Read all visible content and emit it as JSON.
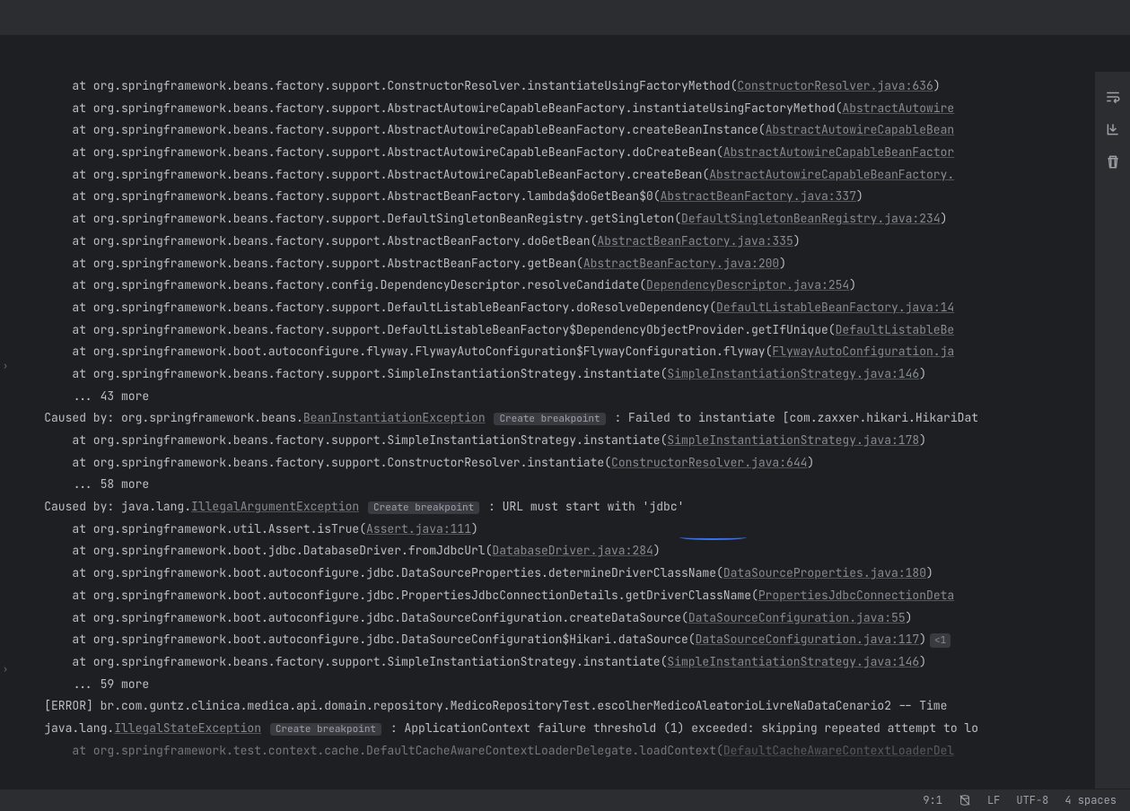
{
  "lines": [
    {
      "indent": "        ",
      "prefix": "at org.springframework.beans.factory.support.ConstructorResolver.instantiateUsingFactoryMethod(",
      "link": "ConstructorResolver.java:636",
      "linkGrey": true,
      "suffix": ")"
    },
    {
      "indent": "        ",
      "prefix": "at org.springframework.beans.factory.support.AbstractAutowireCapableBeanFactory.instantiateUsingFactoryMethod(",
      "link": "AbstractAutowire",
      "linkCut": true,
      "suffix": ""
    },
    {
      "indent": "        ",
      "prefix": "at org.springframework.beans.factory.support.AbstractAutowireCapableBeanFactory.createBeanInstance(",
      "link": "AbstractAutowireCapableBean",
      "linkCut": true,
      "suffix": ""
    },
    {
      "indent": "        ",
      "prefix": "at org.springframework.beans.factory.support.AbstractAutowireCapableBeanFactory.doCreateBean(",
      "link": "AbstractAutowireCapableBeanFactor",
      "linkCut": true,
      "suffix": ""
    },
    {
      "indent": "        ",
      "prefix": "at org.springframework.beans.factory.support.AbstractAutowireCapableBeanFactory.createBean(",
      "link": "AbstractAutowireCapableBeanFactory.",
      "linkCut": true,
      "suffix": ""
    },
    {
      "indent": "        ",
      "prefix": "at org.springframework.beans.factory.support.AbstractBeanFactory.lambda$doGetBean$0(",
      "link": "AbstractBeanFactory.java:337",
      "linkGrey": true,
      "suffix": ")"
    },
    {
      "indent": "        ",
      "prefix": "at org.springframework.beans.factory.support.DefaultSingletonBeanRegistry.getSingleton(",
      "link": "DefaultSingletonBeanRegistry.java:234",
      "linkGrey": true,
      "suffix": ")"
    },
    {
      "indent": "        ",
      "prefix": "at org.springframework.beans.factory.support.AbstractBeanFactory.doGetBean(",
      "link": "AbstractBeanFactory.java:335",
      "linkGrey": true,
      "suffix": ")"
    },
    {
      "indent": "        ",
      "prefix": "at org.springframework.beans.factory.support.AbstractBeanFactory.getBean(",
      "link": "AbstractBeanFactory.java:200",
      "linkGrey": true,
      "suffix": ")"
    },
    {
      "indent": "        ",
      "prefix": "at org.springframework.beans.factory.config.DependencyDescriptor.resolveCandidate(",
      "link": "DependencyDescriptor.java:254",
      "linkGrey": true,
      "suffix": ")"
    },
    {
      "indent": "        ",
      "prefix": "at org.springframework.beans.factory.support.DefaultListableBeanFactory.doResolveDependency(",
      "link": "DefaultListableBeanFactory.java:14",
      "linkCut": true,
      "suffix": ""
    },
    {
      "indent": "        ",
      "prefix": "at org.springframework.beans.factory.support.DefaultListableBeanFactory$DependencyObjectProvider.getIfUnique(",
      "link": "DefaultListableBe",
      "linkCut": true,
      "suffix": ""
    },
    {
      "indent": "        ",
      "prefix": "at org.springframework.boot.autoconfigure.flyway.FlywayAutoConfiguration$FlywayConfiguration.flyway(",
      "link": "FlywayAutoConfiguration.ja",
      "linkCut": true,
      "suffix": "",
      "fold": true
    },
    {
      "indent": "        ",
      "prefix": "at org.springframework.beans.factory.support.SimpleInstantiationStrategy.instantiate(",
      "link": "SimpleInstantiationStrategy.java:146",
      "linkGrey": true,
      "suffix": ")"
    },
    {
      "indent": "        ",
      "prefix": "... 43 more",
      "plain": true
    }
  ],
  "caused1": {
    "prefix": "    Caused by: org.springframework.beans.",
    "exceptionLink": "BeanInstantiationException",
    "breakpoint": "Create breakpoint",
    "suffix": ": Failed to instantiate [com.zaxxer.hikari.HikariDat"
  },
  "caused1_lines": [
    {
      "indent": "        ",
      "prefix": "at org.springframework.beans.factory.support.SimpleInstantiationStrategy.instantiate(",
      "link": "SimpleInstantiationStrategy.java:178",
      "linkGrey": true,
      "suffix": ")"
    },
    {
      "indent": "        ",
      "prefix": "at org.springframework.beans.factory.support.ConstructorResolver.instantiate(",
      "link": "ConstructorResolver.java:644",
      "linkGrey": true,
      "suffix": ")"
    },
    {
      "indent": "        ",
      "prefix": "... 58 more",
      "plain": true
    }
  ],
  "caused2": {
    "prefix": "    Caused by: java.lang.",
    "exceptionLink": "IllegalArgumentException",
    "breakpoint": "Create breakpoint",
    "suffix": ": URL must start with 'jdbc'"
  },
  "caused2_lines": [
    {
      "indent": "        ",
      "prefix": "at org.springframework.util.Assert.isTrue(",
      "link": "Assert.java:111",
      "linkGrey": true,
      "suffix": ")"
    },
    {
      "indent": "        ",
      "prefix": "at org.springframework.boot.jdbc.DatabaseDriver.fromJdbcUrl(",
      "link": "DatabaseDriver.java:284",
      "linkGrey": true,
      "suffix": ")"
    },
    {
      "indent": "        ",
      "prefix": "at org.springframework.boot.autoconfigure.jdbc.DataSourceProperties.determineDriverClassName(",
      "link": "DataSourceProperties.java:180",
      "linkGrey": true,
      "suffix": ")"
    },
    {
      "indent": "        ",
      "prefix": "at org.springframework.boot.autoconfigure.jdbc.PropertiesJdbcConnectionDetails.getDriverClassName(",
      "link": "PropertiesJdbcConnectionDeta",
      "linkCut": true,
      "suffix": ""
    },
    {
      "indent": "        ",
      "prefix": "at org.springframework.boot.autoconfigure.jdbc.DataSourceConfiguration.createDataSource(",
      "link": "DataSourceConfiguration.java:55",
      "linkGrey": true,
      "suffix": ")"
    },
    {
      "indent": "        ",
      "prefix": "at org.springframework.boot.autoconfigure.jdbc.DataSourceConfiguration$Hikari.dataSource(",
      "link": "DataSourceConfiguration.java:117",
      "linkGrey": true,
      "suffix": ")",
      "fold": true,
      "inlay": "<1"
    },
    {
      "indent": "        ",
      "prefix": "at org.springframework.beans.factory.support.SimpleInstantiationStrategy.instantiate(",
      "link": "SimpleInstantiationStrategy.java:146",
      "linkGrey": true,
      "suffix": ")"
    },
    {
      "indent": "        ",
      "prefix": "... 59 more",
      "plain": true
    }
  ],
  "error_line": "    [ERROR] br.com.guntz.clinica.medica.api.domain.repository.MedicoRepositoryTest.escolherMedicoAleatorioLivreNaDataCenario2 -- Time",
  "final": {
    "prefix": "    java.lang.",
    "exceptionLink": "IllegalStateException",
    "breakpoint": "Create breakpoint",
    "suffix": ": ApplicationContext failure threshold (1) exceeded: skipping repeated attempt to lo"
  },
  "last_line": {
    "indent": "        ",
    "prefix": "at org.springframework.test.context.cache.DefaultCacheAwareContextLoaderDelegate.loadContext(",
    "link": "DefaultCacheAwareContextLoaderDel",
    "linkCut": true,
    "dim": true
  },
  "status": {
    "position": "9:1",
    "lineEnding": "LF",
    "encoding": "UTF-8",
    "indent": "4 spaces"
  }
}
